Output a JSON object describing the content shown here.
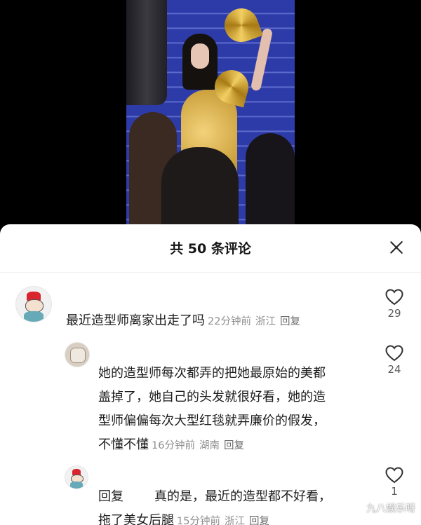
{
  "sheet": {
    "title": "共 50 条评论"
  },
  "comments": [
    {
      "text": "最近造型师离家出走了吗",
      "time": "22分钟前",
      "location": "浙江",
      "reply_label": "回复",
      "likes": "29"
    },
    {
      "text": "她的造型师每次都弄的把她最原始的美都盖掉了，她自己的头发就很好看，她的造型师偏偏每次大型红毯就弄廉价的假发，不懂不懂",
      "lines": [
        "她的造型师每次都弄的把她最原始的美都",
        "盖掉了，她自己的头发就很好看，她的造",
        "型师偏偏每次大型红毯就弄廉价的假发，",
        "不懂不懂"
      ],
      "time": "16分钟前",
      "location": "湖南",
      "reply_label": "回复",
      "likes": "24"
    },
    {
      "reply_prefix": "回复",
      "lines": [
        "真的是，最近的造型都不好看，",
        "拖了美女后腿"
      ],
      "time": "15分钟前",
      "location": "浙江",
      "reply_label": "回复",
      "likes": "1"
    }
  ],
  "watermark": "九八娱乐呀"
}
